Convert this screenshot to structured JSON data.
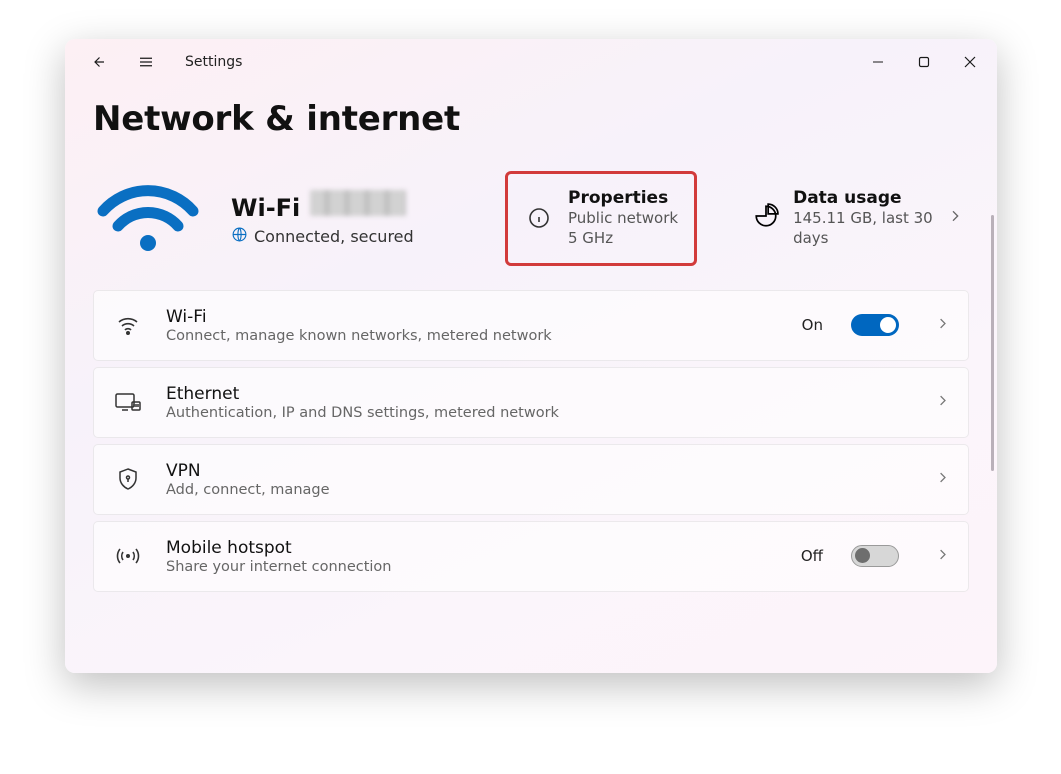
{
  "titlebar": {
    "app_title": "Settings"
  },
  "page": {
    "heading": "Network & internet"
  },
  "connection": {
    "wifi_label": "Wi-Fi",
    "status_text": "Connected, secured"
  },
  "properties_card": {
    "title": "Properties",
    "line1": "Public network",
    "line2": "5 GHz"
  },
  "data_usage_card": {
    "title": "Data usage",
    "sub": "145.11 GB, last 30 days"
  },
  "items": [
    {
      "title": "Wi-Fi",
      "sub": "Connect, manage known networks, metered network",
      "state_label": "On",
      "toggle": "on"
    },
    {
      "title": "Ethernet",
      "sub": "Authentication, IP and DNS settings, metered network"
    },
    {
      "title": "VPN",
      "sub": "Add, connect, manage"
    },
    {
      "title": "Mobile hotspot",
      "sub": "Share your internet connection",
      "state_label": "Off",
      "toggle": "off"
    }
  ]
}
